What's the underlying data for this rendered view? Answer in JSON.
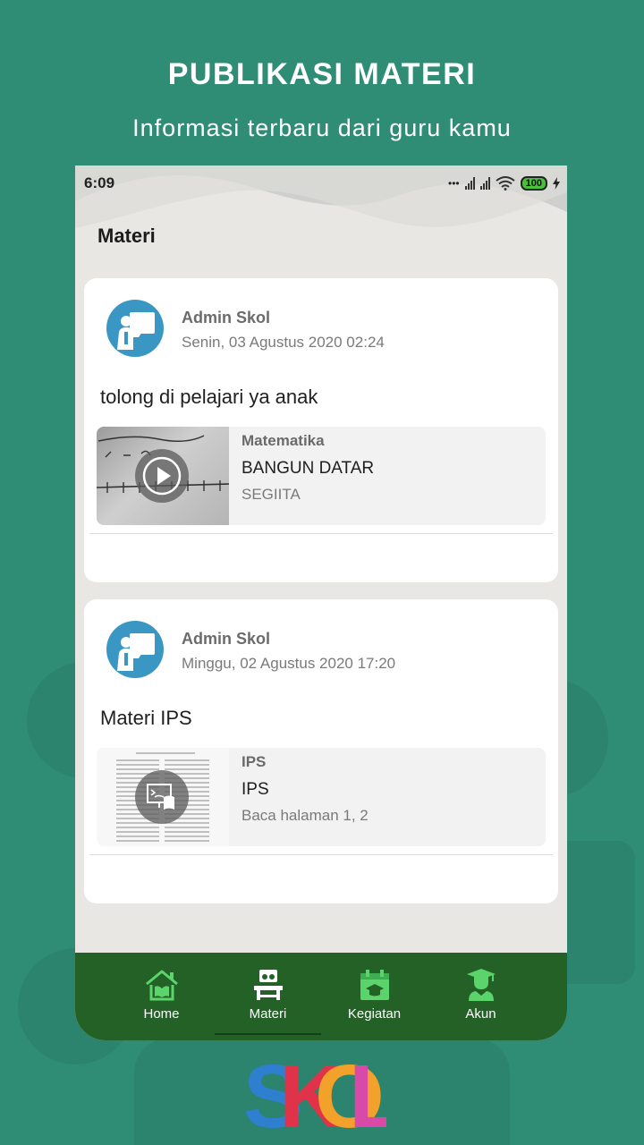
{
  "promo": {
    "title": "PUBLIKASI MATERI",
    "subtitle": "Informasi terbaru dari guru kamu"
  },
  "status_bar": {
    "time": "6:09",
    "dots": "•••",
    "battery": "100"
  },
  "header": {
    "title": "Materi"
  },
  "posts": [
    {
      "author": "Admin Skol",
      "date": "Senin, 03 Agustus 2020 02:24",
      "message": "tolong di pelajari ya anak",
      "attachment": {
        "type": "video",
        "subject": "Matematika",
        "title": "BANGUN DATAR",
        "description": "SEGIITA"
      }
    },
    {
      "author": "Admin Skol",
      "date": "Minggu, 02 Agustus 2020 17:20",
      "message": "Materi IPS",
      "attachment": {
        "type": "document",
        "subject": "IPS",
        "title": "IPS",
        "description": "Baca halaman 1, 2"
      }
    }
  ],
  "bottom_nav": {
    "items": [
      {
        "label": "Home",
        "icon": "home-book-icon"
      },
      {
        "label": "Materi",
        "icon": "desk-icon",
        "active": true
      },
      {
        "label": "Kegiatan",
        "icon": "calendar-cap-icon"
      },
      {
        "label": "Akun",
        "icon": "graduate-icon"
      }
    ]
  },
  "brand": {
    "logo_text": "SKOL",
    "colors": {
      "S": "#2f7fd0",
      "K": "#e0334a",
      "O": "#f2a12a",
      "L": "#d84aa8"
    }
  },
  "colors": {
    "background": "#2f8c75",
    "nav": "#236127",
    "avatar": "#3a97c4"
  }
}
